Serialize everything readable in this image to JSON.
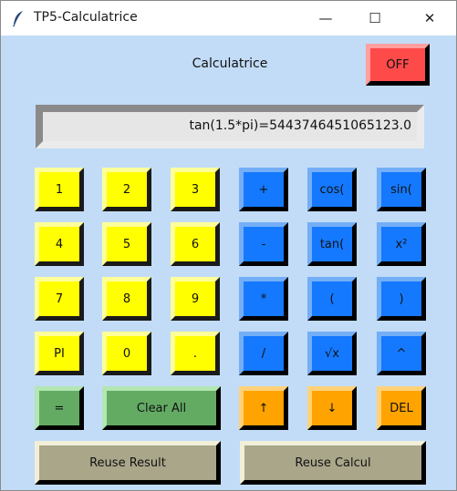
{
  "window": {
    "title": "TP5-Calculatrice"
  },
  "titlebar": {
    "minimize": "—",
    "maximize": "☐",
    "close": "✕"
  },
  "heading": "Calculatrice",
  "off_button": "OFF",
  "display": "tan(1.5*pi)=5443746451065123.0",
  "keys": {
    "k1": "1",
    "k2": "2",
    "k3": "3",
    "k4": "4",
    "k5": "5",
    "k6": "6",
    "k7": "7",
    "k8": "8",
    "k9": "9",
    "pi": "PI",
    "k0": "0",
    "dot": ".",
    "plus": "+",
    "minus": "-",
    "times": "*",
    "divide": "/",
    "cos": "cos(",
    "sin": "sin(",
    "tan": "tan(",
    "square": "x²",
    "lparen": "(",
    "rparen": ")",
    "sqrt": "√x",
    "power": "^",
    "equals": "=",
    "clear_all": "Clear All",
    "up": "↑",
    "down": "↓",
    "del": "DEL",
    "reuse_result": "Reuse Result",
    "reuse_calcul": "Reuse Calcul"
  },
  "colors": {
    "window_bg": "#c2dcf7",
    "digit": "#ffff00",
    "operator": "#1479ff",
    "off": "#ff4a4a",
    "equals": "#63ab63",
    "arrow": "#ffa300",
    "reuse": "#aaa68a"
  }
}
